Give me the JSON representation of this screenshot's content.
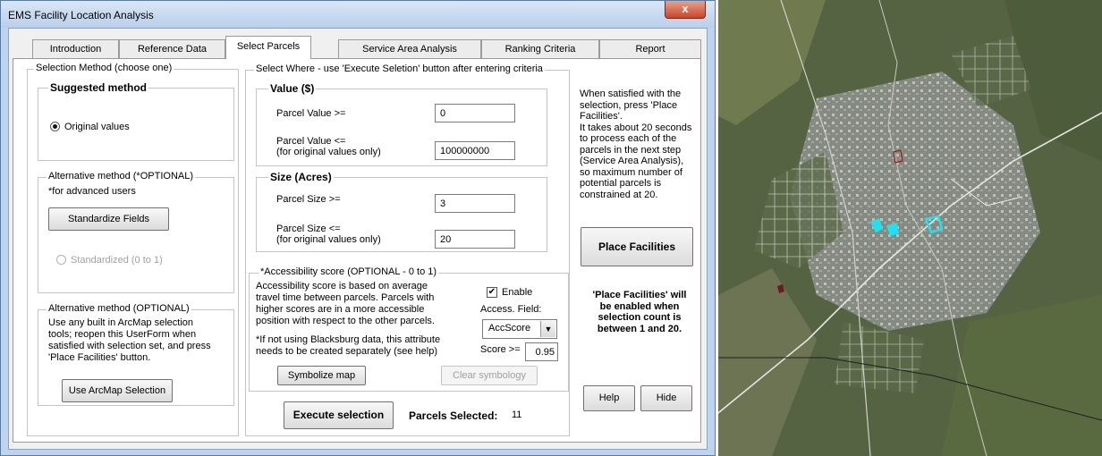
{
  "window": {
    "title": "EMS Facility Location Analysis",
    "close_glyph": "x"
  },
  "tabs": [
    {
      "label": "Introduction"
    },
    {
      "label": "Reference Data"
    },
    {
      "label": "Select Parcels"
    },
    {
      "label": "Service Area Analysis"
    },
    {
      "label": "Ranking Criteria"
    },
    {
      "label": "Report"
    }
  ],
  "selection_method": {
    "legend": "Selection Method (choose one)",
    "suggested": {
      "legend": "Suggested method",
      "radio_label": "Original values",
      "selected": true
    },
    "alternative1": {
      "legend": "Alternative method (*OPTIONAL)",
      "note": "*for advanced users",
      "button": "Standardize Fields",
      "radio_label": "Standardized (0 to 1)"
    },
    "alternative2": {
      "legend": "Alternative method (OPTIONAL)",
      "lines": [
        "Use any built in ArcMap selection",
        "tools; reopen this UserForm when",
        "satisfied with selection set, and press",
        "'Place Facilities' button."
      ],
      "button": "Use ArcMap Selection"
    }
  },
  "select_where": {
    "legend": "Select Where - use 'Execute Seletion' button after entering criteria",
    "value": {
      "legend": "Value ($)",
      "min_label": "Parcel Value >=",
      "min_value": "0",
      "max_label": "Parcel Value <=",
      "max_note": "(for original values only)",
      "max_value": "100000000"
    },
    "size": {
      "legend": "Size (Acres)",
      "min_label": "Parcel Size >=",
      "min_value": "3",
      "max_label": "Parcel Size <=",
      "max_note": "(for original values only)",
      "max_value": "20"
    },
    "accessibility": {
      "legend": "*Accessibility score (OPTIONAL - 0 to 1)",
      "lines": [
        "Accessibility score is based on average",
        "travel time between parcels. Parcels with",
        "higher scores are in a more accessible",
        "position with respect to the other parcels."
      ],
      "note_lines": [
        "*If not using Blacksburg data, this attribute",
        "needs to be created separately (see help)"
      ],
      "enable_label": "Enable",
      "enabled": true,
      "field_label": "Access. Field:",
      "field_value": "AccScore",
      "score_label": "Score >=",
      "score_value": "0.95",
      "symbolize_button": "Symbolize map",
      "clear_button": "Clear symbology"
    },
    "execute_button": "Execute selection",
    "parcels_selected_label": "Parcels Selected:",
    "parcels_selected_value": "11"
  },
  "right_panel": {
    "info_lines": [
      "When satisfied with the",
      "selection, press 'Place",
      "Facilities'.",
      "It takes about 20 seconds",
      "to process each of the",
      "parcels in the next step",
      "(Service Area Analysis),",
      "so maximum number of",
      "potential parcels is",
      "constrained at 20."
    ],
    "place_button": "Place Facilities",
    "warning_lines": [
      "'Place Facilities' will",
      "be enabled when",
      "selection count is",
      "between 1 and 20."
    ],
    "help_button": "Help",
    "hide_button": "Hide"
  },
  "map": {
    "description_icon": "aerial-map-icon"
  }
}
